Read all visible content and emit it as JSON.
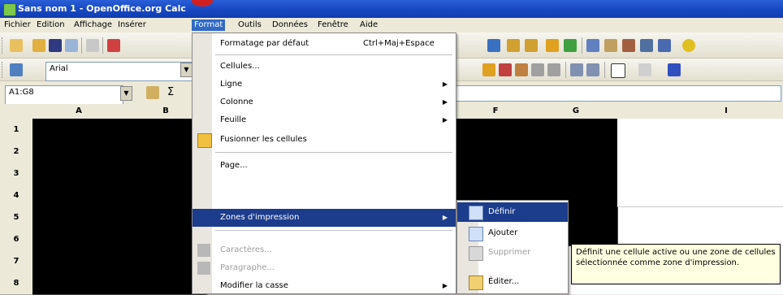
{
  "window": {
    "title": "Sans nom 1 - OpenOffice.org Calc"
  },
  "menubar": {
    "items": [
      "Fichier",
      "Edition",
      "Affichage",
      "Insérer",
      "Format",
      "Outils",
      "Données",
      "Fenêtre",
      "Aide"
    ],
    "active": "Format"
  },
  "toolbar": {
    "font_name": "Arial"
  },
  "formula_bar": {
    "cell_ref": "A1:G8",
    "autosum_icon": "Σ"
  },
  "sheet": {
    "columns": [
      "A",
      "B",
      "",
      "",
      "F",
      "G",
      "",
      "I"
    ],
    "rows": [
      "1",
      "2",
      "3",
      "4",
      "5",
      "6",
      "7",
      "8"
    ]
  },
  "format_menu": {
    "top_item": {
      "label": "Formatage par défaut",
      "shortcut": "Ctrl+Maj+Espace"
    },
    "items": [
      {
        "label": "Cellules..."
      },
      {
        "label": "Ligne"
      },
      {
        "label": "Colonne"
      },
      {
        "label": "Feuille"
      },
      {
        "label": "Fusionner les cellules"
      },
      {
        "label": "Page..."
      },
      {
        "label": "Zones d'impression"
      },
      {
        "label": "Caractères..."
      },
      {
        "label": "Paragraphe..."
      },
      {
        "label": "Modifier la casse"
      }
    ]
  },
  "print_range_submenu": {
    "items": [
      "Définir",
      "Ajouter",
      "Supprimer",
      "Éditer..."
    ]
  },
  "tooltip": {
    "text": "Définit une cellule active ou une zone de cellules sélectionnée comme zone d'impression."
  },
  "colors": {
    "highlight": "#1c3c8c",
    "title_blue": "#1a4bc5",
    "tooltip_bg": "#ffffe1"
  }
}
